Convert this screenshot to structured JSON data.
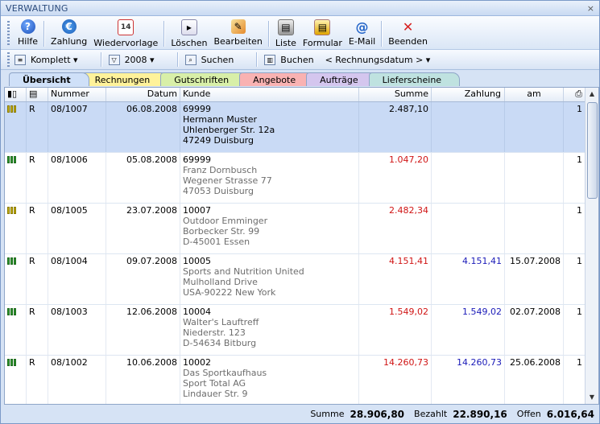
{
  "window": {
    "title": "VERWALTUNG",
    "close": "×"
  },
  "toolbar": [
    {
      "label": "Hilfe",
      "icon": "help-icon",
      "glyph": "?"
    },
    {
      "label": "Zahlung",
      "icon": "euro-payment-icon",
      "glyph": "€"
    },
    {
      "label": "Wiedervorlage",
      "icon": "calendar-icon",
      "glyph": "14"
    },
    {
      "label": "Löschen",
      "icon": "delete-icon",
      "glyph": "▸"
    },
    {
      "label": "Bearbeiten",
      "icon": "edit-pencil-icon",
      "glyph": "✎"
    },
    {
      "label": "Liste",
      "icon": "printer-list-icon",
      "glyph": "▤"
    },
    {
      "label": "Formular",
      "icon": "printer-form-icon",
      "glyph": "▤"
    },
    {
      "label": "E-Mail",
      "icon": "email-at-icon",
      "glyph": "@"
    },
    {
      "label": "Beenden",
      "icon": "exit-x-icon",
      "glyph": "✕"
    }
  ],
  "filterbar": {
    "view": "Komplett ▾",
    "year": "2008 ▾",
    "search": "Suchen",
    "book": "Buchen",
    "sort": "< Rechnungsdatum > ▾"
  },
  "tabs": [
    "Übersicht",
    "Rechnungen",
    "Gutschriften",
    "Angebote",
    "Aufträge",
    "Lieferscheine"
  ],
  "columns": {
    "nummer": "Nummer",
    "datum": "Datum",
    "kunde": "Kunde",
    "summe": "Summe",
    "zahlung": "Zahlung",
    "am": "am"
  },
  "rows": [
    {
      "status": "y",
      "typ": "R",
      "nummer": "08/1007",
      "datum": "06.08.2008",
      "kundennr": "69999",
      "name": "Hermann Muster",
      "strasse": "Uhlenberger Str. 12a",
      "ort": "47249 Duisburg",
      "summe": "2.487,10",
      "summe_color": "black",
      "zahlung": "",
      "am": "",
      "count": "1",
      "selected": true
    },
    {
      "status": "g",
      "typ": "R",
      "nummer": "08/1006",
      "datum": "05.08.2008",
      "kundennr": "69999",
      "name": "Franz Dornbusch",
      "strasse": "Wegener Strasse 77",
      "ort": "47053 Duisburg",
      "summe": "1.047,20",
      "summe_color": "red",
      "zahlung": "",
      "am": "",
      "count": "1",
      "selected": false
    },
    {
      "status": "y",
      "typ": "R",
      "nummer": "08/1005",
      "datum": "23.07.2008",
      "kundennr": "10007",
      "name": "Outdoor Emminger",
      "strasse": "Borbecker Str. 99",
      "ort": "D-45001 Essen",
      "summe": "2.482,34",
      "summe_color": "red",
      "zahlung": "",
      "am": "",
      "count": "1",
      "selected": false
    },
    {
      "status": "g",
      "typ": "R",
      "nummer": "08/1004",
      "datum": "09.07.2008",
      "kundennr": "10005",
      "name": "Sports and Nutrition United",
      "strasse": "Mulholland Drive",
      "ort": "USA-90222 New York",
      "summe": "4.151,41",
      "summe_color": "red",
      "zahlung": "4.151,41",
      "am": "15.07.2008",
      "count": "1",
      "selected": false
    },
    {
      "status": "g",
      "typ": "R",
      "nummer": "08/1003",
      "datum": "12.06.2008",
      "kundennr": "10004",
      "name": "Walter's Lauftreff",
      "strasse": "Niederstr. 123",
      "ort": "D-54634 Bitburg",
      "summe": "1.549,02",
      "summe_color": "red",
      "zahlung": "1.549,02",
      "am": "02.07.2008",
      "count": "1",
      "selected": false
    },
    {
      "status": "g",
      "typ": "R",
      "nummer": "08/1002",
      "datum": "10.06.2008",
      "kundennr": "10002",
      "name": "Das Sportkaufhaus",
      "strasse": "Sport Total AG",
      "ort": "Lindauer Str. 9",
      "summe": "14.260,73",
      "summe_color": "red",
      "zahlung": "14.260,73",
      "am": "25.06.2008",
      "count": "1",
      "selected": false
    }
  ],
  "totals": {
    "summe_label": "Summe",
    "summe": "28.906,80",
    "bezahlt_label": "Bezahlt",
    "bezahlt": "22.890,16",
    "offen_label": "Offen",
    "offen": "6.016,64"
  },
  "colors": {
    "selected_row": "#c9daf5",
    "amount_open": "#d01414",
    "amount_paid": "#1a1ab8"
  }
}
